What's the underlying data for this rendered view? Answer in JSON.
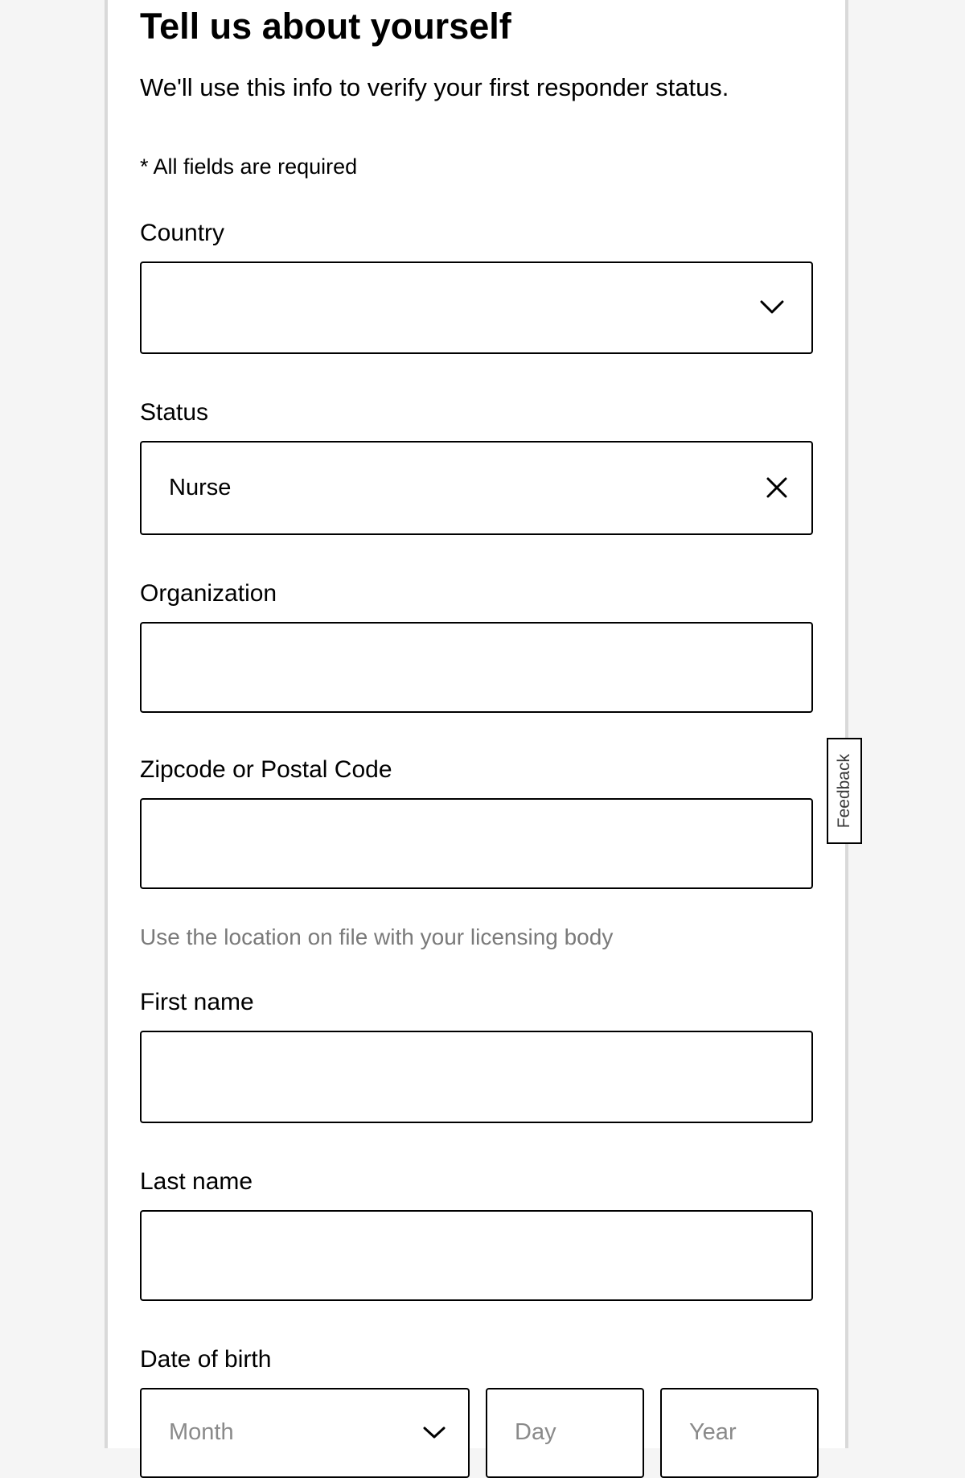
{
  "form": {
    "title": "Tell us about yourself",
    "subtitle": "We'll use this info to verify your first responder status.",
    "required_note": "* All fields are required",
    "fields": {
      "country": {
        "label": "Country",
        "value": ""
      },
      "status": {
        "label": "Status",
        "value": "Nurse"
      },
      "organization": {
        "label": "Organization",
        "value": ""
      },
      "zipcode": {
        "label": "Zipcode or Postal Code",
        "value": "",
        "helper": "Use the location on file with your licensing body"
      },
      "first_name": {
        "label": "First name",
        "value": ""
      },
      "last_name": {
        "label": "Last name",
        "value": ""
      },
      "dob": {
        "label": "Date of birth",
        "month_placeholder": "Month",
        "day_placeholder": "Day",
        "year_placeholder": "Year"
      }
    }
  },
  "feedback": {
    "label": "Feedback"
  }
}
